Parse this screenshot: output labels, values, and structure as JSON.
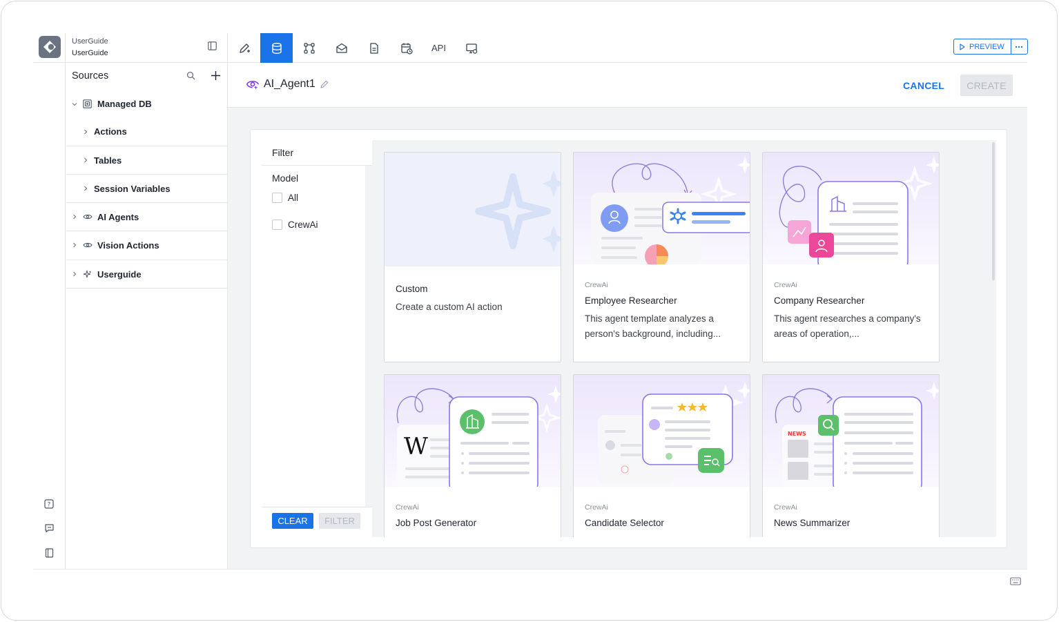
{
  "app": {
    "org": "UserGuide",
    "name": "UserGuide"
  },
  "toolbar": {
    "items": [
      "pen-plus-icon",
      "database-icon",
      "workflow-icon",
      "mail-icon",
      "document-icon",
      "calendar-clock-icon",
      "API",
      "monitor-gear-icon"
    ],
    "api_label": "API",
    "preview_label": "PREVIEW"
  },
  "sources": {
    "title": "Sources",
    "managed_db": "Managed DB",
    "children": [
      "Actions",
      "Tables",
      "Session Variables"
    ],
    "ai_agents": "AI Agents",
    "vision_actions": "Vision Actions",
    "userguide": "Userguide"
  },
  "editor": {
    "agent_name": "AI_Agent1",
    "cancel_label": "CANCEL",
    "create_label": "CREATE"
  },
  "filter": {
    "title": "Filter",
    "model_title": "Model",
    "options": [
      "All",
      "CrewAi"
    ],
    "clear_label": "CLEAR",
    "filter_label": "FILTER"
  },
  "cards": [
    {
      "tag": "",
      "title": "Custom",
      "desc": "Create a custom AI action"
    },
    {
      "tag": "CrewAi",
      "title": "Employee Researcher",
      "desc": "This agent template analyzes a person's background, including..."
    },
    {
      "tag": "CrewAi",
      "title": "Company Researcher",
      "desc": "This agent researches a company's areas of operation,..."
    },
    {
      "tag": "CrewAi",
      "title": "Job Post Generator",
      "desc": ""
    },
    {
      "tag": "CrewAi",
      "title": "Candidate Selector",
      "desc": ""
    },
    {
      "tag": "CrewAi",
      "title": "News Summarizer",
      "desc": ""
    }
  ],
  "art_text": {
    "wiki_letter": "W",
    "news_badge": "NEWS"
  },
  "colors": {
    "accent": "#1a73e8",
    "agent_icon": "#7c3aed",
    "art_purple": "#7c5cf0",
    "art_pink": "#ec4899",
    "art_green": "#4caf50"
  }
}
